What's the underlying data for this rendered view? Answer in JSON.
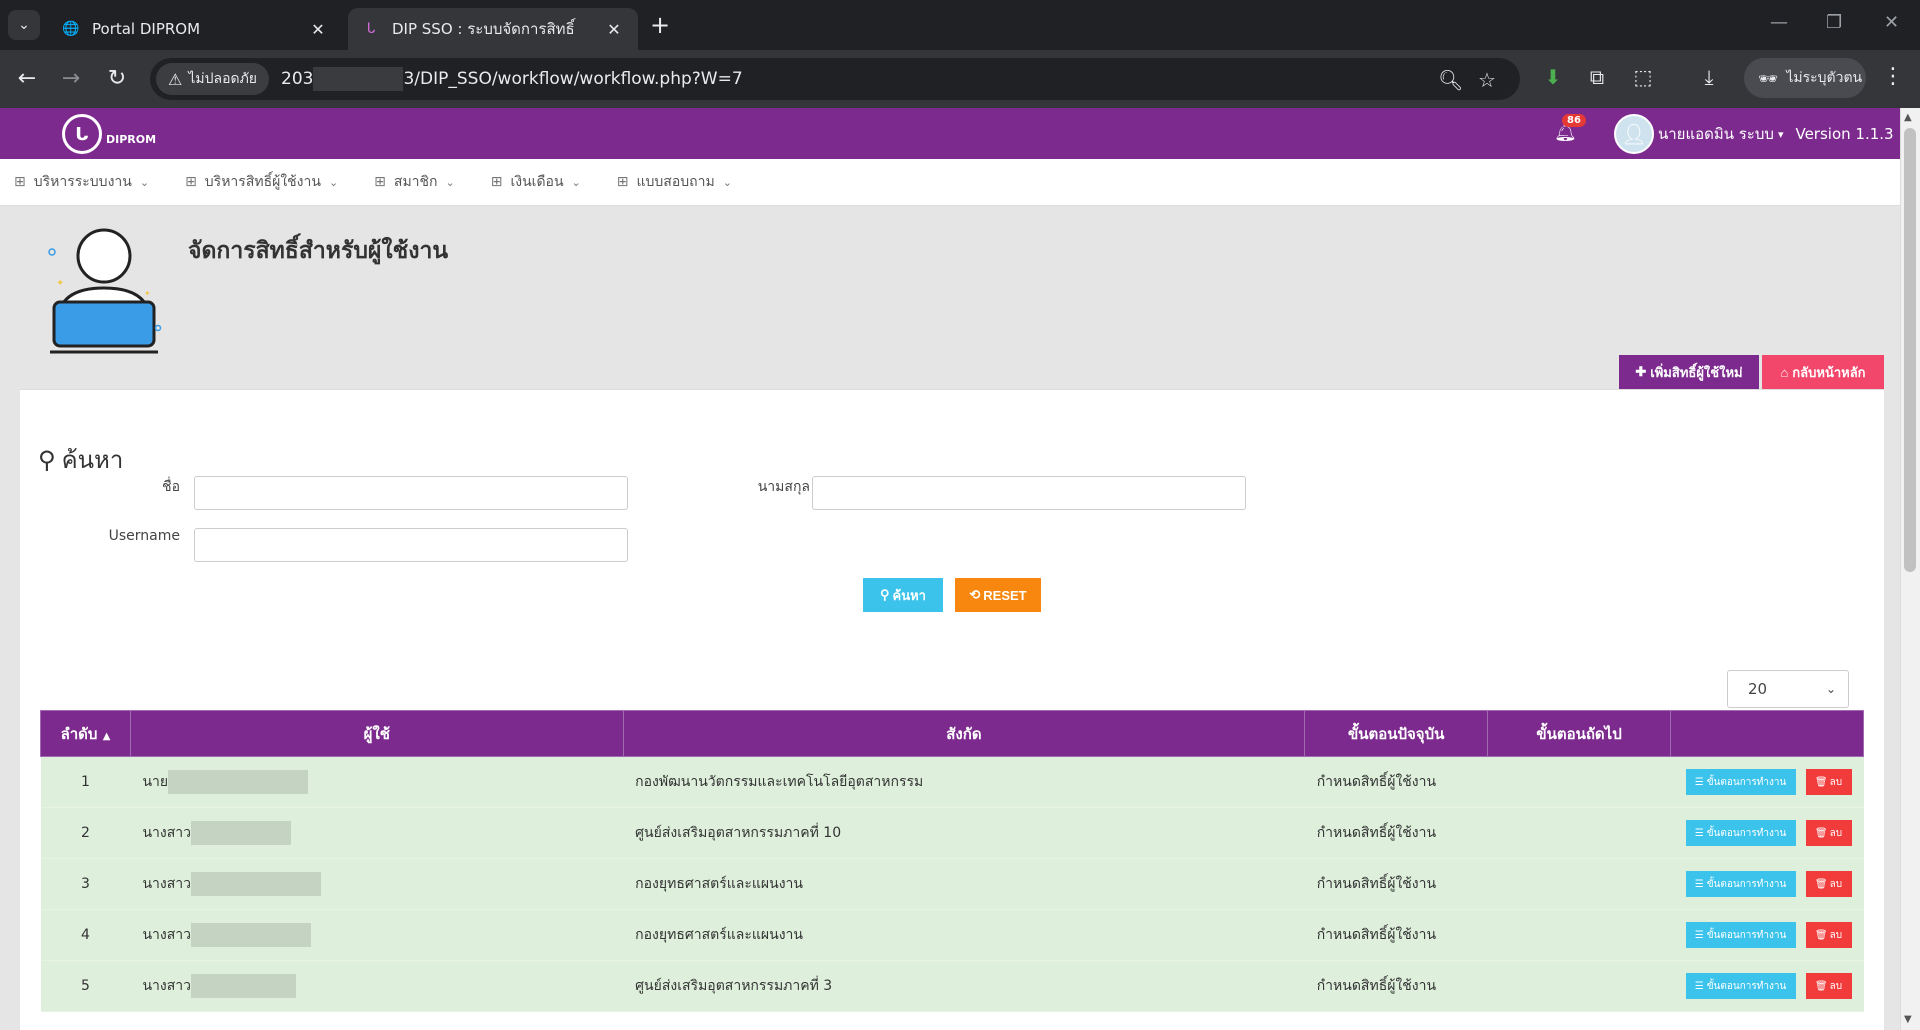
{
  "browser": {
    "tabs": [
      {
        "title": "Portal DIPROM",
        "icon": "globe-icon"
      },
      {
        "title": "DIP SSO : ระบบจัดการสิทธิ์",
        "icon": "diprom-favicon-icon"
      }
    ],
    "security_label": "ไม่ปลอดภัย",
    "url_prefix": "203",
    "url_suffix": "3/DIP_SSO/workflow/workflow.php?W=7",
    "profile_label": "ไม่ระบุตัวตน"
  },
  "header": {
    "logo_text": "DIPROM",
    "notification_count": "86",
    "user_name": "นายแอดมิน ระบบ",
    "version": "Version 1.1.3"
  },
  "menu": {
    "items": [
      {
        "label": "บริหารระบบงาน"
      },
      {
        "label": "บริหารสิทธิ์ผู้ใช้งาน"
      },
      {
        "label": "สมาชิก"
      },
      {
        "label": "เงินเดือน"
      },
      {
        "label": "แบบสอบถาม"
      }
    ]
  },
  "page": {
    "title": "จัดการสิทธิ์สำหรับผู้ใช้งาน",
    "add_button": "เพิ่มสิทธิ์ผู้ใช้ใหม่",
    "home_button": "กลับหน้าหลัก"
  },
  "search": {
    "title": "ค้นหา",
    "first_name_label": "ชื่อ",
    "last_name_label": "นามสกุล",
    "username_label": "Username",
    "first_name_value": "",
    "last_name_value": "",
    "username_value": "",
    "search_button": "ค้นหา",
    "reset_button": "RESET"
  },
  "table": {
    "page_size": "20",
    "columns": [
      "ลำดับ",
      "ผู้ใช้",
      "สังกัด",
      "ขั้นตอนปัจจุบัน",
      "ขั้นตอนถัดไป",
      ""
    ],
    "workflow_button": "ขั้นตอนการทำงาน",
    "delete_button": "ลบ",
    "rows": [
      {
        "no": "1",
        "name": "นาย",
        "org": "กองพัฒนานวัตกรรมและเทคโนโลยีอุตสาหกรรม",
        "current_step": "กำหนดสิทธิ์ผู้ใช้งาน",
        "next_step": ""
      },
      {
        "no": "2",
        "name": "นางสาว",
        "org": "ศูนย์ส่งเสริมอุตสาหกรรมภาคที่ 10",
        "current_step": "กำหนดสิทธิ์ผู้ใช้งาน",
        "next_step": ""
      },
      {
        "no": "3",
        "name": "นางสาว",
        "org": "กองยุทธศาสตร์และแผนงาน",
        "current_step": "กำหนดสิทธิ์ผู้ใช้งาน",
        "next_step": ""
      },
      {
        "no": "4",
        "name": "นางสาว",
        "org": "กองยุทธศาสตร์และแผนงาน",
        "current_step": "กำหนดสิทธิ์ผู้ใช้งาน",
        "next_step": ""
      },
      {
        "no": "5",
        "name": "นางสาว",
        "org": "ศูนย์ส่งเสริมอุตสาหกรรมภาคที่ 3",
        "current_step": "กำหนดสิทธิ์ผู้ใช้งาน",
        "next_step": ""
      }
    ]
  },
  "colors": {
    "brand_purple": "#7d2a8f",
    "row_green": "#def0dc",
    "search_blue": "#3bc3ec",
    "reset_orange": "#f7870f",
    "delete_red": "#f23c3c",
    "home_pink": "#f2476a"
  }
}
